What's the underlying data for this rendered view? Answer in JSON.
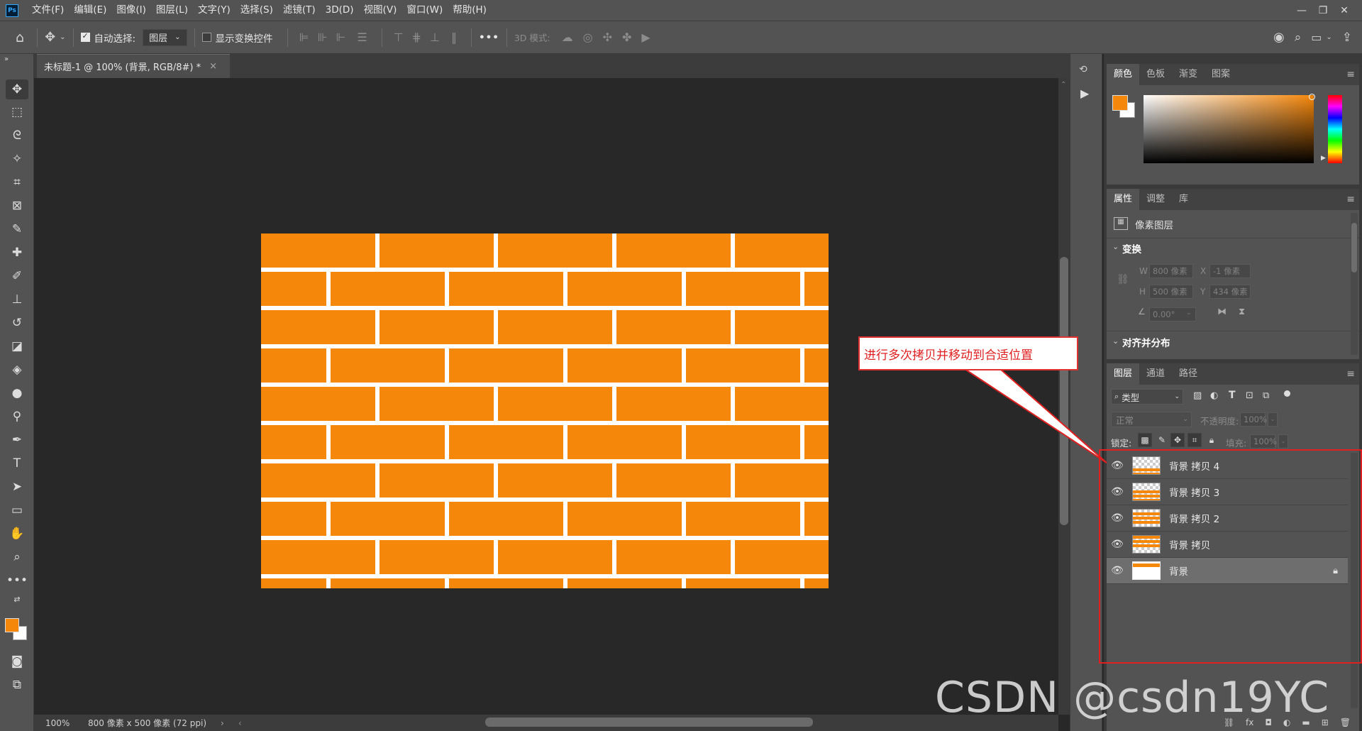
{
  "app": {
    "logo": "Ps"
  },
  "menu": [
    "文件(F)",
    "编辑(E)",
    "图像(I)",
    "图层(L)",
    "文字(Y)",
    "选择(S)",
    "滤镜(T)",
    "3D(D)",
    "视图(V)",
    "窗口(W)",
    "帮助(H)"
  ],
  "options": {
    "auto_select_label": "自动选择:",
    "auto_select_value": "图层",
    "show_transform_label": "显示变换控件",
    "more_label": "•••",
    "mode_3d_label": "3D 模式:"
  },
  "document": {
    "tab_title": "未标题-1 @ 100% (背景, RGB/8#) *",
    "close": "×"
  },
  "status": {
    "zoom": "100%",
    "doc_info": "800 像素 x 500 像素 (72 ppi)"
  },
  "color_panel": {
    "tabs": [
      "颜色",
      "色板",
      "渐变",
      "图案"
    ],
    "fg_color": "#f5870b",
    "bg_color": "#ffffff"
  },
  "properties_panel": {
    "tabs": [
      "属性",
      "调整",
      "库"
    ],
    "layer_kind": "像素图层",
    "transform_title": "变换",
    "w_label": "W",
    "w_value": "800 像素",
    "x_label": "X",
    "x_value": "-1 像素",
    "h_label": "H",
    "h_value": "500 像素",
    "y_label": "Y",
    "y_value": "434 像素",
    "angle_value": "0.00°",
    "align_title": "对齐并分布"
  },
  "layers_panel": {
    "tabs": [
      "图层",
      "通道",
      "路径"
    ],
    "filter_label": "类型",
    "blend_mode": "正常",
    "opacity_label": "不透明度:",
    "opacity_value": "100%",
    "lock_label": "锁定:",
    "fill_label": "填充:",
    "fill_value": "100%",
    "layers": [
      {
        "name": "背景 拷贝 4",
        "locked": false
      },
      {
        "name": "背景 拷贝 3",
        "locked": false
      },
      {
        "name": "背景 拷贝 2",
        "locked": false
      },
      {
        "name": "背景 拷贝",
        "locked": false
      },
      {
        "name": "背景",
        "locked": true
      }
    ]
  },
  "annotation": {
    "callout_text": "进行多次拷贝并移动到合适位置"
  },
  "watermark": "CSDN @csdn19YC"
}
